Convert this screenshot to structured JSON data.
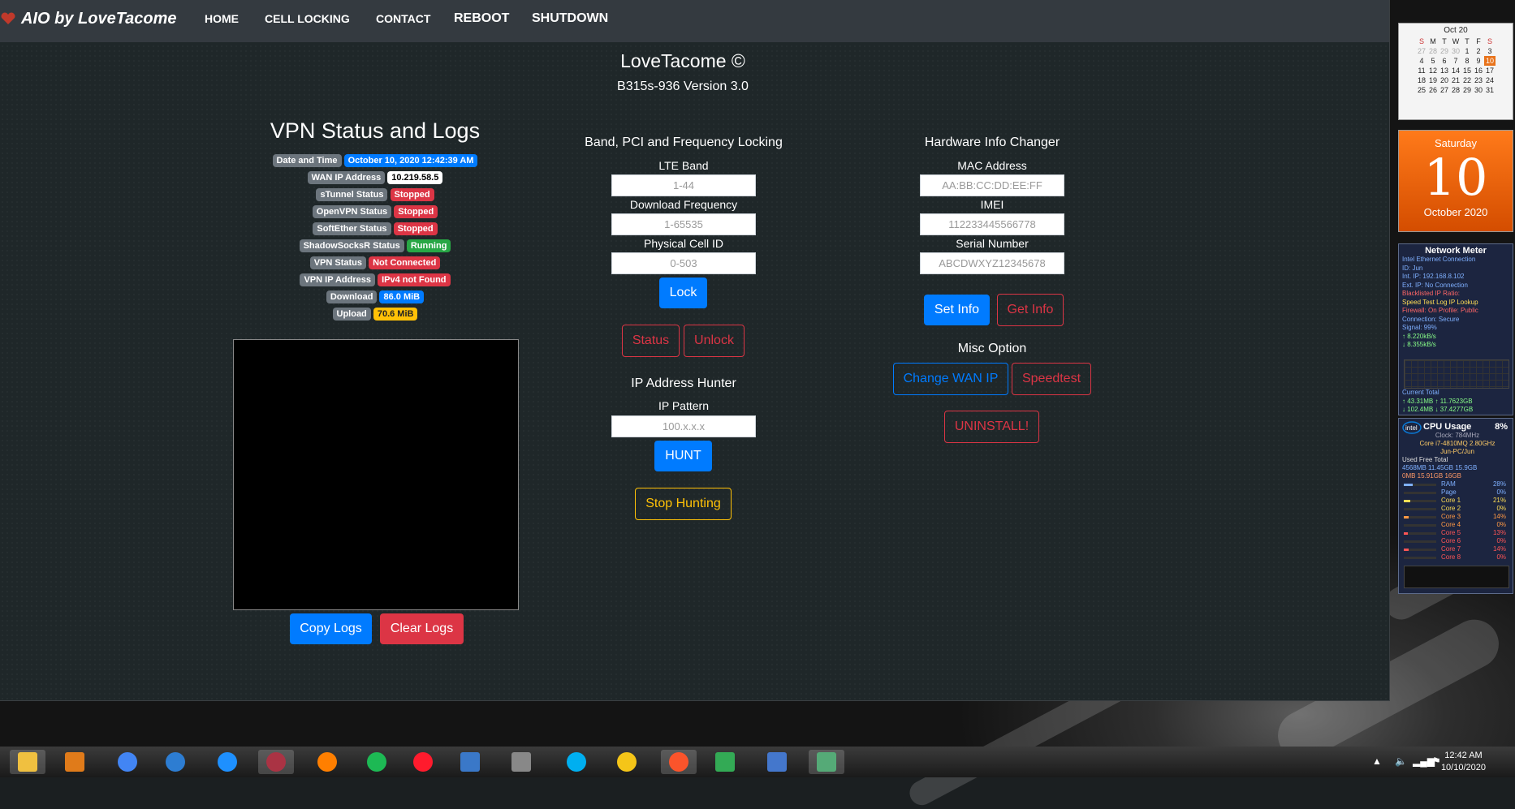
{
  "navbar": {
    "brand": "AIO by LoveTacome",
    "links": [
      "HOME",
      "CELL LOCKING",
      "CONTACT",
      "REBOOT",
      "SHUTDOWN"
    ]
  },
  "header": {
    "title": "LoveTacome ©",
    "subtitle": "B315s-936 Version 3.0"
  },
  "vpn": {
    "title": "VPN Status and Logs",
    "rows": [
      {
        "label": "Date and Time",
        "value": "October 10, 2020 12:42:39 AM",
        "color": "#007bff"
      },
      {
        "label": "WAN IP Address",
        "value": "10.219.58.5",
        "color": "#ffffff"
      },
      {
        "label": "sTunnel Status",
        "value": "Stopped",
        "color": "#dc3545"
      },
      {
        "label": "OpenVPN Status",
        "value": "Stopped",
        "color": "#dc3545"
      },
      {
        "label": "SoftEther Status",
        "value": "Stopped",
        "color": "#dc3545"
      },
      {
        "label": "ShadowSocksR Status",
        "value": "Running",
        "color": "#28a745"
      },
      {
        "label": "VPN Status",
        "value": "Not Connected",
        "color": "#dc3545"
      },
      {
        "label": "VPN IP Address",
        "value": "IPv4 not Found",
        "color": "#dc3545"
      },
      {
        "label": "Download",
        "value": "86.0 MiB",
        "color": "#007bff"
      },
      {
        "label": "Upload",
        "value": "70.6 MiB",
        "color": "#ffc107"
      }
    ],
    "copy_logs": "Copy Logs",
    "clear_logs": "Clear Logs"
  },
  "band": {
    "title": "Band, PCI and Frequency Locking",
    "lte_label": "LTE Band",
    "lte_placeholder": "1-44",
    "freq_label": "Download Frequency",
    "freq_placeholder": "1-65535",
    "pci_label": "Physical Cell ID",
    "pci_placeholder": "0-503",
    "lock": "Lock",
    "status": "Status",
    "unlock": "Unlock"
  },
  "hunter": {
    "title": "IP Address Hunter",
    "pattern_label": "IP Pattern",
    "pattern_placeholder": "100.x.x.x",
    "hunt": "HUNT",
    "stop": "Stop Hunting"
  },
  "hardware": {
    "title": "Hardware Info Changer",
    "mac_label": "MAC Address",
    "mac_placeholder": "AA:BB:CC:DD:EE:FF",
    "imei_label": "IMEI",
    "imei_placeholder": "112233445566778",
    "serial_label": "Serial Number",
    "serial_placeholder": "ABCDWXYZ12345678",
    "set_info": "Set Info",
    "get_info": "Get Info"
  },
  "misc": {
    "title": "Misc Option",
    "change_wan": "Change WAN IP",
    "speedtest": "Speedtest",
    "uninstall": "UNINSTALL!"
  },
  "calendar": {
    "month": "Oct 20",
    "weekdays": [
      "S",
      "M",
      "T",
      "W",
      "T",
      "F",
      "S"
    ],
    "weeks": [
      [
        "27",
        "28",
        "29",
        "30",
        "1",
        "2",
        "3"
      ],
      [
        "4",
        "5",
        "6",
        "7",
        "8",
        "9",
        "10"
      ],
      [
        "11",
        "12",
        "13",
        "14",
        "15",
        "16",
        "17"
      ],
      [
        "18",
        "19",
        "20",
        "21",
        "22",
        "23",
        "24"
      ],
      [
        "25",
        "26",
        "27",
        "28",
        "29",
        "30",
        "31"
      ]
    ]
  },
  "day_gadget": {
    "weekday": "Saturday",
    "day": "10",
    "month_year": "October 2020"
  },
  "network_meter": {
    "title": "Network Meter",
    "lines": [
      "Intel Ethernet Connection",
      "ID: Jun",
      "Int. IP: 192.168.8.102",
      "Ext. IP: No Connection",
      "Blacklisted IP Ratio:",
      "Speed Test   Log   IP Lookup",
      "Firewall: On   Profile: Public",
      "Connection: Secure",
      "Signal: 99%",
      "↑ 8.220kB/s",
      "↓ 8.355kB/s"
    ],
    "footer": [
      "Current       Total",
      "↑ 43.31MB     ↑ 11.7623GB",
      "↓ 102.4MB     ↓ 37.4277GB"
    ]
  },
  "cpu": {
    "title": "CPU Usage",
    "percent": "8%",
    "clock": "Clock: 784MHz",
    "model": "Core i7-4810MQ 2.80GHz",
    "host": "Jun-PC/Jun",
    "mem_header": "Used       Free        Total",
    "mem1": "4568MB    11.45GB    15.9GB",
    "mem2": "0MB        15.91GB    16GB",
    "rows": [
      {
        "name": "RAM",
        "pct": "28%"
      },
      {
        "name": "Page",
        "pct": "0%"
      },
      {
        "name": "Core 1",
        "pct": "21%"
      },
      {
        "name": "Core 2",
        "pct": "0%"
      },
      {
        "name": "Core 3",
        "pct": "14%"
      },
      {
        "name": "Core 4",
        "pct": "0%"
      },
      {
        "name": "Core 5",
        "pct": "13%"
      },
      {
        "name": "Core 6",
        "pct": "0%"
      },
      {
        "name": "Core 7",
        "pct": "14%"
      },
      {
        "name": "Core 8",
        "pct": "0%"
      }
    ]
  },
  "taskbar": {
    "time": "12:42 AM",
    "date": "10/10/2020",
    "apps": [
      "file-explorer-icon",
      "media-player-icon",
      "chrome-icon",
      "ie-icon",
      "sync-icon",
      "app-icon",
      "music-icon",
      "spotify-icon",
      "opera-icon",
      "computer-icon",
      "speedometer-icon",
      "skype-icon",
      "winamp-icon",
      "brave-icon",
      "chart-icon",
      "network-icon",
      "window-icon"
    ],
    "colors": [
      "#f0c040",
      "#e07b1a",
      "#4285f4",
      "#2d7dd2",
      "#1e90ff",
      "#aa3344",
      "#ff7f00",
      "#1db954",
      "#ff1b2d",
      "#3a78c8",
      "#888888",
      "#00aff0",
      "#f5c518",
      "#fb542b",
      "#33aa55",
      "#4477cc",
      "#55aa77"
    ]
  }
}
